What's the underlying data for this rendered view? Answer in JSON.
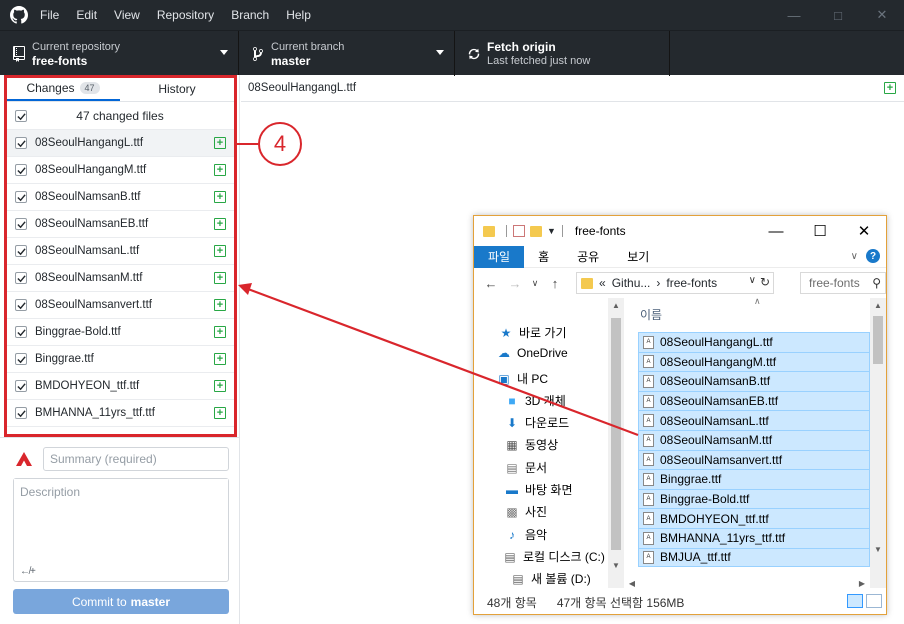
{
  "menu": [
    "File",
    "Edit",
    "View",
    "Repository",
    "Branch",
    "Help"
  ],
  "toolbar": {
    "repo_label": "Current repository",
    "repo_value": "free-fonts",
    "branch_label": "Current branch",
    "branch_value": "master",
    "fetch_title": "Fetch origin",
    "fetch_sub": "Last fetched just now"
  },
  "tabs": {
    "changes": "Changes",
    "changes_count": "47",
    "history": "History"
  },
  "changed_files_header": "47 changed files",
  "files": [
    "08SeoulHangangL.ttf",
    "08SeoulHangangM.ttf",
    "08SeoulNamsanB.ttf",
    "08SeoulNamsanEB.ttf",
    "08SeoulNamsanL.ttf",
    "08SeoulNamsanM.ttf",
    "08SeoulNamsanvert.ttf",
    "Binggrae-Bold.ttf",
    "Binggrae.ttf",
    "BMDOHYEON_ttf.ttf",
    "BMHANNA_11yrs_ttf.ttf"
  ],
  "commit": {
    "summary_placeholder": "Summary (required)",
    "description_placeholder": "Description",
    "button_prefix": "Commit to",
    "button_branch": "master"
  },
  "diff_header_file": "08SeoulHangangL.ttf",
  "callout_number": "4",
  "colors": {
    "accent": "#0366d6",
    "annotation": "#d9262c",
    "commit_button": "#79a6dc",
    "added": "#28a745"
  },
  "explorer": {
    "title": "free-fonts",
    "ribbon_tabs": [
      "파일",
      "홈",
      "공유",
      "보기"
    ],
    "breadcrumb_parent": "Githu...",
    "breadcrumb_current": "free-fonts",
    "search_placeholder": "free-fonts",
    "column_name": "이름",
    "nav_items": [
      "바로 가기",
      "OneDrive",
      "내 PC",
      "3D 개체",
      "다운로드",
      "동영상",
      "문서",
      "바탕 화면",
      "사진",
      "음악",
      "로컬 디스크 (C:)",
      "새 볼륨 (D:)"
    ],
    "files": [
      "08SeoulHangangL.ttf",
      "08SeoulHangangM.ttf",
      "08SeoulNamsanB.ttf",
      "08SeoulNamsanEB.ttf",
      "08SeoulNamsanL.ttf",
      "08SeoulNamsanM.ttf",
      "08SeoulNamsanvert.ttf",
      "Binggrae.ttf",
      "Binggrae-Bold.ttf",
      "BMDOHYEON_ttf.ttf",
      "BMHANNA_11yrs_ttf.ttf",
      "BMJUA_ttf.ttf"
    ],
    "status_count": "48개 항목",
    "status_selection": "47개 항목 선택함 156MB"
  }
}
